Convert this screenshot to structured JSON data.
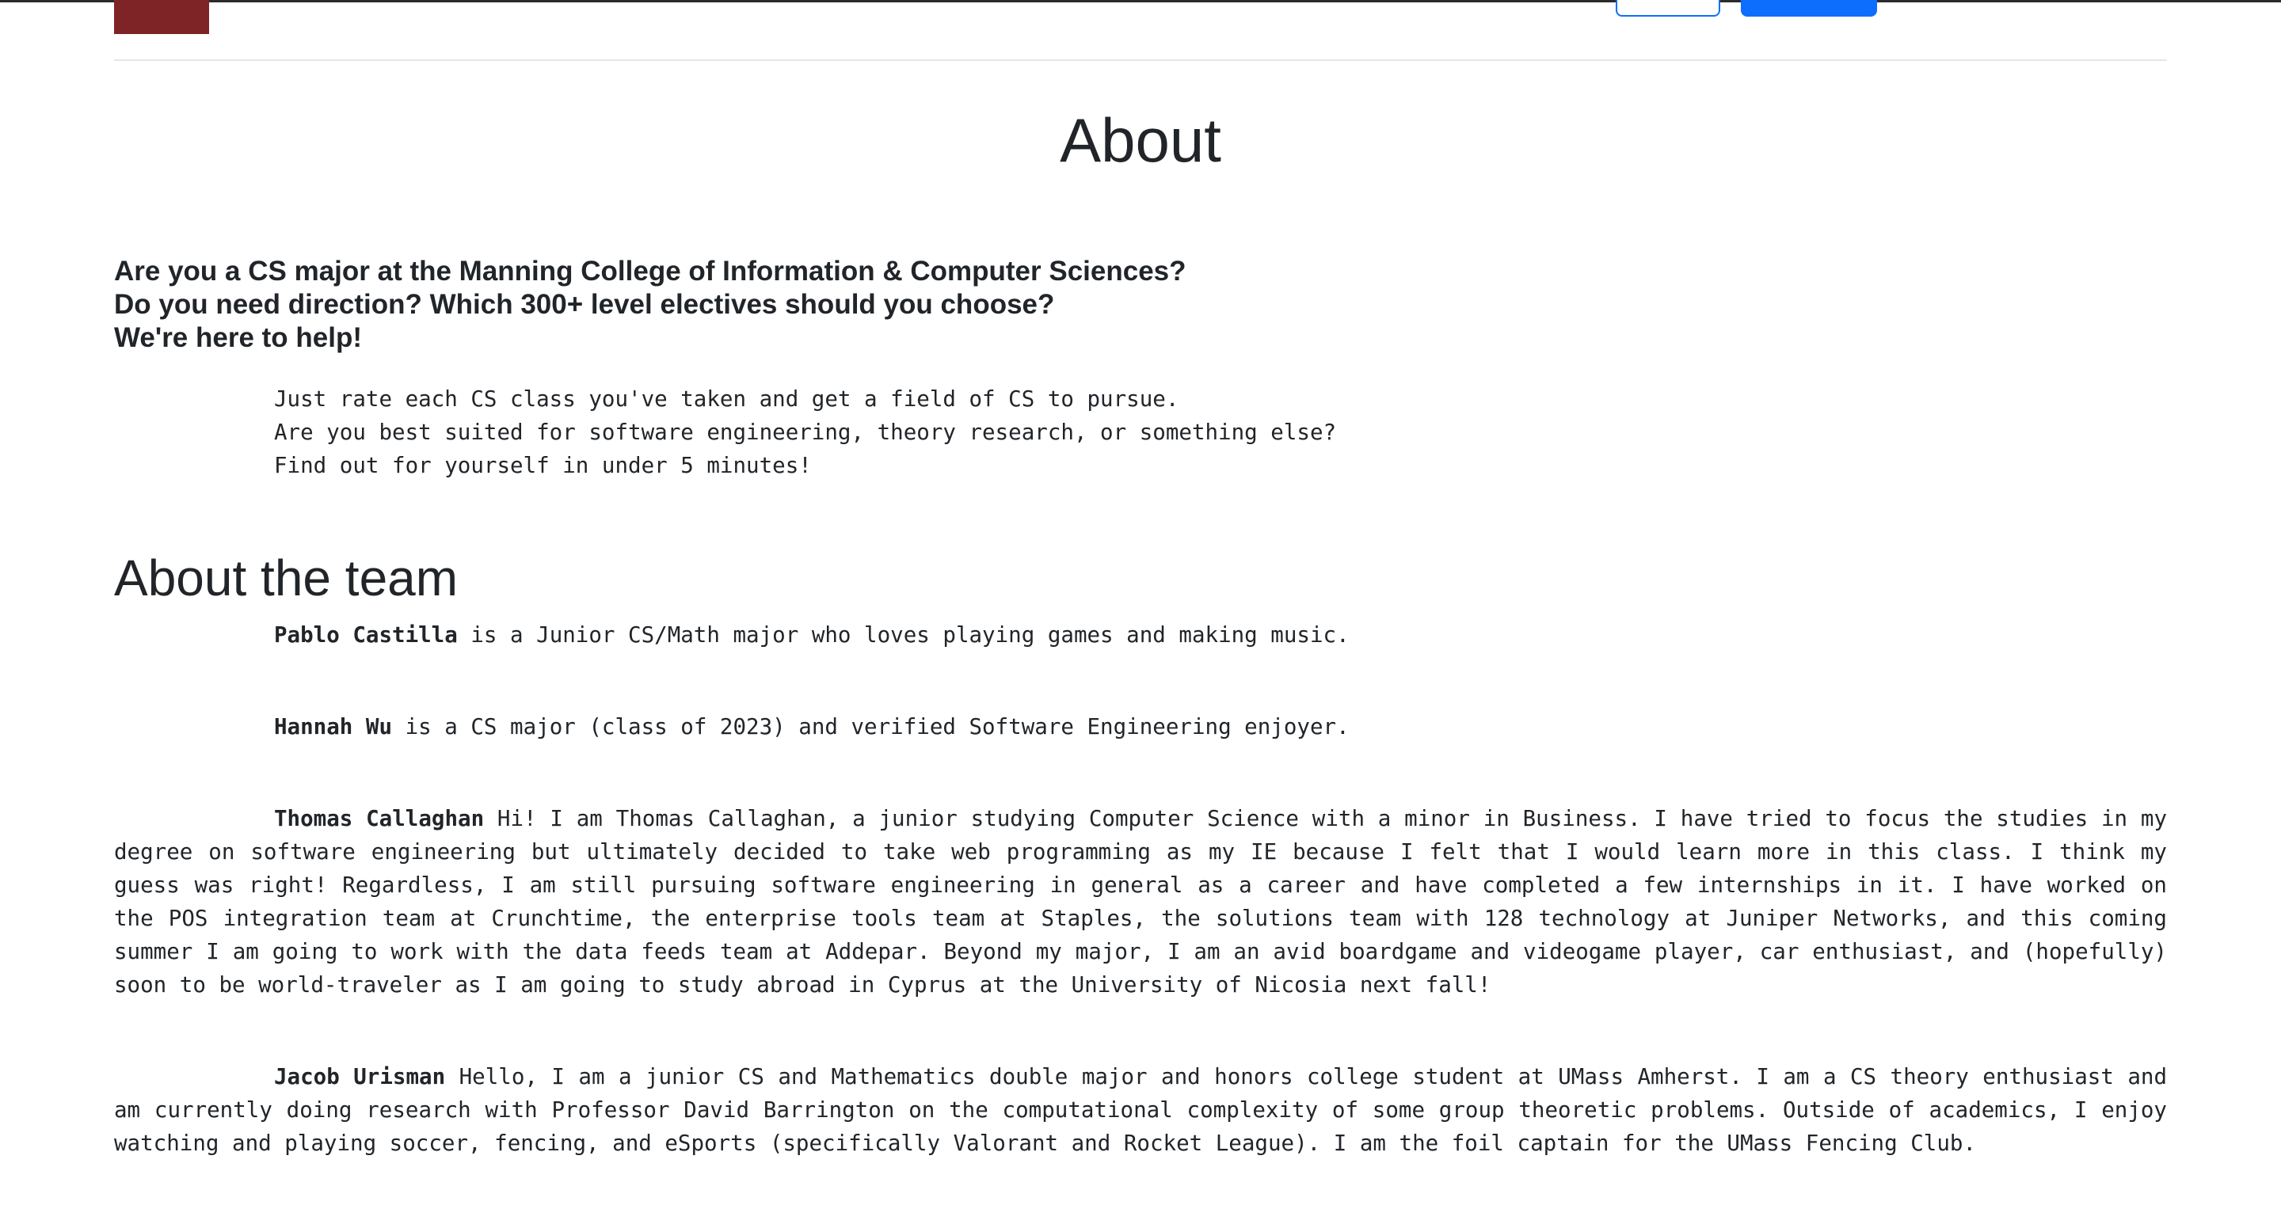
{
  "intro": {
    "line1": "Are you a CS major at the Manning College of Information & Computer Sciences?",
    "line2": "Do you need direction? Which 300+ level electives should you choose?",
    "line3": "We're here to help!"
  },
  "page": {
    "title": "About"
  },
  "pitch": {
    "line1": "Just rate each CS class you've taken and get a field of CS to pursue.",
    "line2": "Are you best suited for software engineering, theory research, or something else?",
    "line3": "Find out for yourself in under 5 minutes!"
  },
  "team": {
    "heading": "About the team",
    "members": [
      {
        "name": "Pablo Castilla",
        "bio": " is a Junior CS/Math major who loves playing games and making music."
      },
      {
        "name": "Hannah Wu",
        "bio": " is a CS major (class of 2023) and verified Software Engineering enjoyer."
      },
      {
        "name": "Thomas Callaghan",
        "bio": " Hi! I am Thomas Callaghan, a junior studying Computer Science with a minor in Business. I have tried to focus the studies in my degree on software engineering but ultimately decided to take web programming as my IE because I felt that I would learn more in this class. I think my guess was right! Regardless, I am still pursuing software engineering in general as a career and have completed a few internships in it. I have worked on the POS integration team at Crunchtime, the enterprise tools team at Staples, the solutions team with 128 technology at Juniper Networks, and this coming summer I am going to work with the data feeds team at Addepar. Beyond my major, I am an avid boardgame and videogame player, car enthusiast, and (hopefully) soon to be world-traveler as I am going to study abroad in Cyprus at the University of Nicosia next fall!"
      },
      {
        "name": "Jacob Urisman",
        "bio": " Hello, I am a junior CS and Mathematics double major and honors college student at UMass Amherst. I am a CS theory enthusiast and am currently doing research with Professor David Barrington on the computational complexity of some group theoretic problems. Outside of academics, I enjoy watching and playing soccer, fencing, and eSports (specifically Valorant and Rocket League). I am the foil captain for the UMass Fencing Club."
      }
    ]
  },
  "theme": {
    "brand_color": "#7f2426",
    "primary_color": "#0d6efd",
    "text_color": "#212529"
  }
}
